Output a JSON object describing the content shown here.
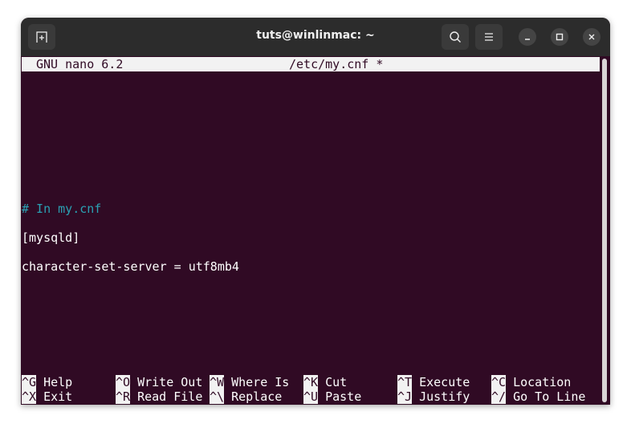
{
  "window": {
    "title": "tuts@winlinmac: ~"
  },
  "colors": {
    "terminal_bg": "#300a24",
    "comment": "#2aa1b3",
    "titlebar_bg": "#f2f2f2",
    "header_bg": "#2c2c2c"
  },
  "nano": {
    "version": "GNU nano 6.2",
    "filename": "/etc/my.cnf *"
  },
  "lines": [
    {
      "row": 10,
      "text": "# In my.cnf",
      "type": "comment"
    },
    {
      "row": 12,
      "text": "[mysqld]",
      "type": "text"
    },
    {
      "row": 14,
      "text": "character-set-server = utf8mb4",
      "type": "text"
    }
  ],
  "shortcuts": [
    [
      {
        "key": "^G",
        "label": "Help"
      },
      {
        "key": "^X",
        "label": "Exit"
      }
    ],
    [
      {
        "key": "^O",
        "label": "Write Out"
      },
      {
        "key": "^R",
        "label": "Read File"
      }
    ],
    [
      {
        "key": "^W",
        "label": "Where Is"
      },
      {
        "key": "^\\",
        "label": "Replace"
      }
    ],
    [
      {
        "key": "^K",
        "label": "Cut"
      },
      {
        "key": "^U",
        "label": "Paste"
      }
    ],
    [
      {
        "key": "^T",
        "label": "Execute"
      },
      {
        "key": "^J",
        "label": "Justify"
      }
    ],
    [
      {
        "key": "^C",
        "label": "Location"
      },
      {
        "key": "^/",
        "label": "Go To Line"
      }
    ]
  ],
  "icons": {
    "new_tab": "new-tab-icon",
    "search": "search-icon",
    "menu": "hamburger-menu-icon",
    "minimize": "minimize-icon",
    "maximize": "maximize-icon",
    "close": "close-icon"
  }
}
